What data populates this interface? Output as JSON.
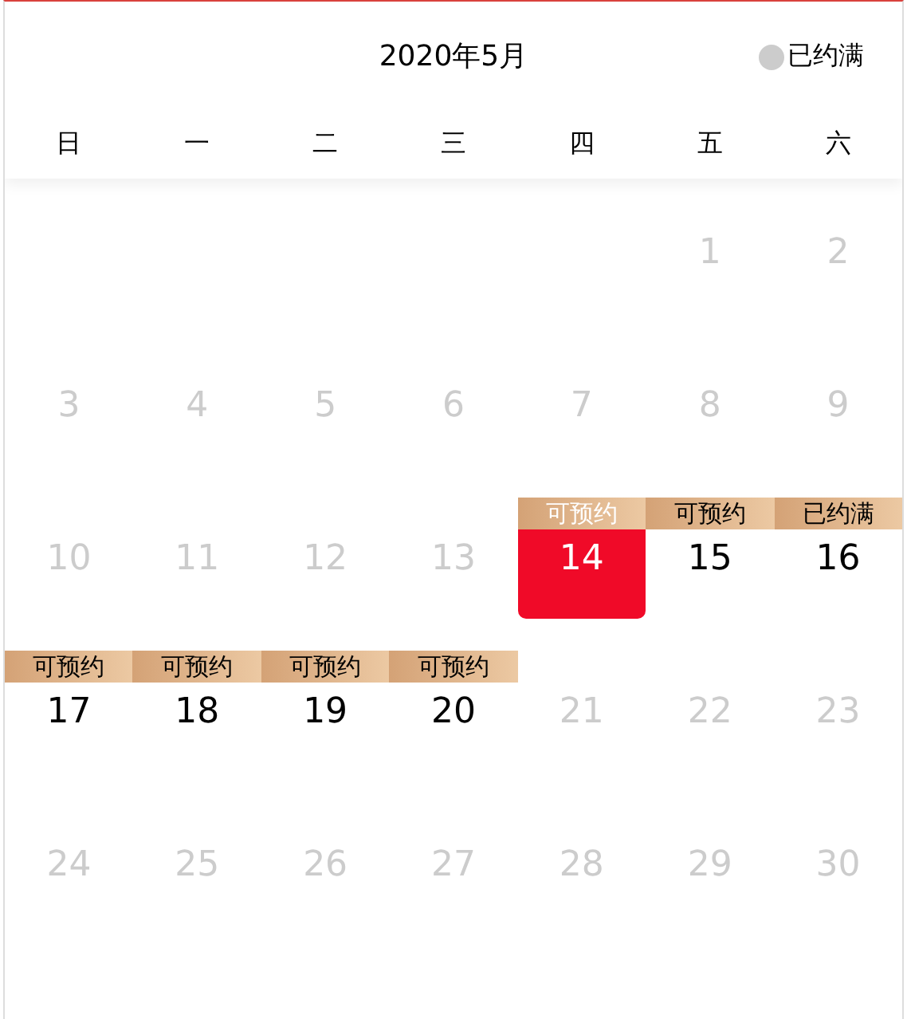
{
  "title": "2020年5月",
  "legend": {
    "label": "已约满"
  },
  "weekdays": [
    "日",
    "一",
    "二",
    "三",
    "四",
    "五",
    "六"
  ],
  "weeks": [
    [
      {
        "kind": "blank"
      },
      {
        "kind": "blank"
      },
      {
        "kind": "blank"
      },
      {
        "kind": "blank"
      },
      {
        "kind": "blank"
      },
      {
        "kind": "day",
        "day": "1",
        "disabled": true,
        "selected": false
      },
      {
        "kind": "day",
        "day": "2",
        "disabled": true,
        "selected": false
      }
    ],
    [
      {
        "kind": "day",
        "day": "3",
        "disabled": true,
        "selected": false
      },
      {
        "kind": "day",
        "day": "4",
        "disabled": true,
        "selected": false
      },
      {
        "kind": "day",
        "day": "5",
        "disabled": true,
        "selected": false
      },
      {
        "kind": "day",
        "day": "6",
        "disabled": true,
        "selected": false
      },
      {
        "kind": "day",
        "day": "7",
        "disabled": true,
        "selected": false
      },
      {
        "kind": "day",
        "day": "8",
        "disabled": true,
        "selected": false
      },
      {
        "kind": "day",
        "day": "9",
        "disabled": true,
        "selected": false
      }
    ],
    [
      {
        "kind": "day",
        "day": "10",
        "disabled": true,
        "selected": false
      },
      {
        "kind": "day",
        "day": "11",
        "disabled": true,
        "selected": false
      },
      {
        "kind": "day",
        "day": "12",
        "disabled": true,
        "selected": false
      },
      {
        "kind": "day",
        "day": "13",
        "disabled": true,
        "selected": false
      },
      {
        "kind": "day",
        "day": "14",
        "disabled": false,
        "selected": true,
        "badge": "可预约"
      },
      {
        "kind": "day",
        "day": "15",
        "disabled": false,
        "selected": false,
        "badge": "可预约"
      },
      {
        "kind": "day",
        "day": "16",
        "disabled": false,
        "selected": false,
        "badge": "已约满"
      }
    ],
    [
      {
        "kind": "day",
        "day": "17",
        "disabled": false,
        "selected": false,
        "badge": "可预约"
      },
      {
        "kind": "day",
        "day": "18",
        "disabled": false,
        "selected": false,
        "badge": "可预约"
      },
      {
        "kind": "day",
        "day": "19",
        "disabled": false,
        "selected": false,
        "badge": "可预约"
      },
      {
        "kind": "day",
        "day": "20",
        "disabled": false,
        "selected": false,
        "badge": "可预约"
      },
      {
        "kind": "day",
        "day": "21",
        "disabled": true,
        "selected": false
      },
      {
        "kind": "day",
        "day": "22",
        "disabled": true,
        "selected": false
      },
      {
        "kind": "day",
        "day": "23",
        "disabled": true,
        "selected": false
      }
    ],
    [
      {
        "kind": "day",
        "day": "24",
        "disabled": true,
        "selected": false
      },
      {
        "kind": "day",
        "day": "25",
        "disabled": true,
        "selected": false
      },
      {
        "kind": "day",
        "day": "26",
        "disabled": true,
        "selected": false
      },
      {
        "kind": "day",
        "day": "27",
        "disabled": true,
        "selected": false
      },
      {
        "kind": "day",
        "day": "28",
        "disabled": true,
        "selected": false
      },
      {
        "kind": "day",
        "day": "29",
        "disabled": true,
        "selected": false
      },
      {
        "kind": "day",
        "day": "30",
        "disabled": true,
        "selected": false
      }
    ]
  ]
}
